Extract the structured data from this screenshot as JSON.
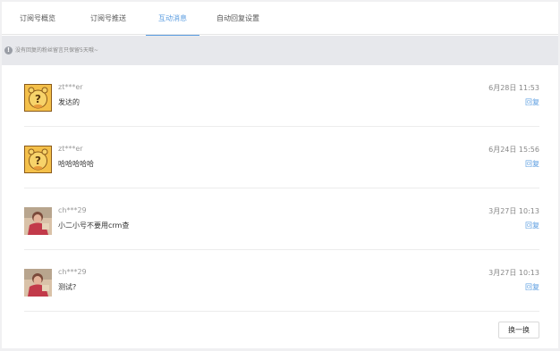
{
  "tabs": [
    {
      "label": "订阅号概览"
    },
    {
      "label": "订阅号推送"
    },
    {
      "label": "互动消息"
    },
    {
      "label": "自动回复设置"
    }
  ],
  "notice": {
    "icon": "info-icon",
    "text": "没有回复的粉丝留言只保留5天哦~"
  },
  "messages": [
    {
      "name": "zt***er",
      "content": "发达的",
      "time": "6月28日 11:53",
      "reply": "回复",
      "avatar": "cartoon-mascot-avatar"
    },
    {
      "name": "zt***er",
      "content": "哈哈哈哈哈",
      "time": "6月24日 15:56",
      "reply": "回复",
      "avatar": "cartoon-mascot-avatar"
    },
    {
      "name": "ch***29",
      "content": "小二小号不要用crm查",
      "time": "3月27日 10:13",
      "reply": "回复",
      "avatar": "photo-avatar"
    },
    {
      "name": "ch***29",
      "content": "测试?",
      "time": "3月27日 10:13",
      "reply": "回复",
      "avatar": "photo-avatar"
    }
  ],
  "refresh_button": "换一换",
  "colors": {
    "accent": "#5a9ce0",
    "notice_bg": "#e7e8ec",
    "page_bg": "#f0f0f2"
  }
}
